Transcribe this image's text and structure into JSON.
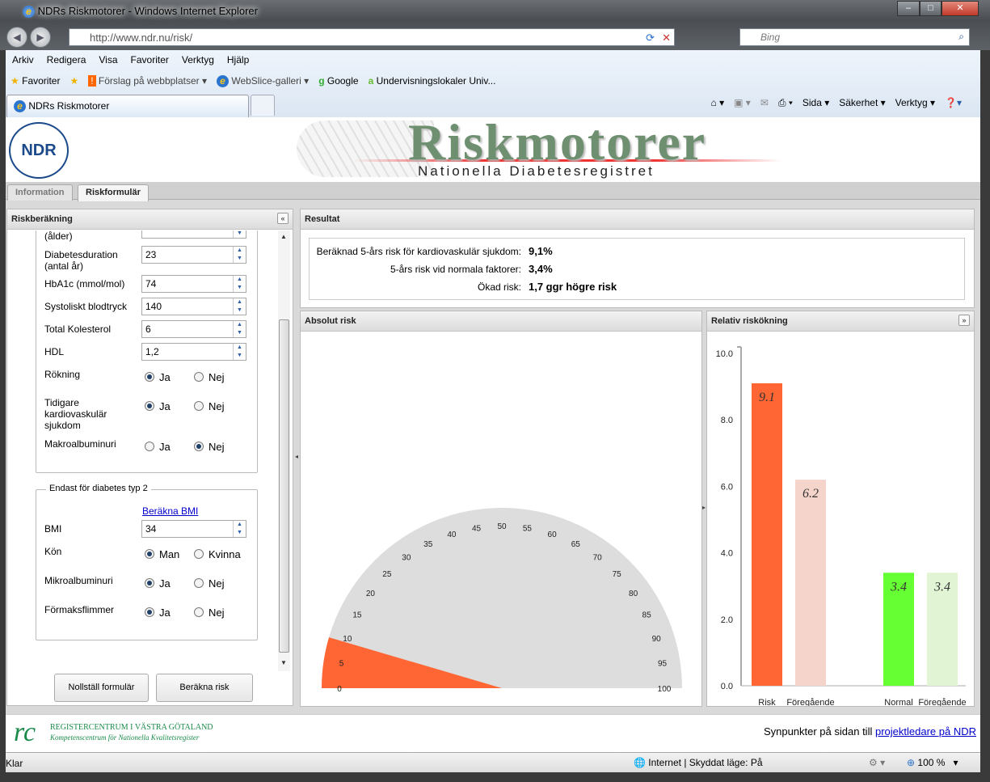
{
  "window": {
    "title": "NDRs Riskmotorer - Windows Internet Explorer",
    "url": "http://www.ndr.nu/risk/",
    "search_placeholder": "Bing",
    "minimize": "‒",
    "maximize": "□",
    "close": "✕"
  },
  "menu": [
    "Arkiv",
    "Redigera",
    "Visa",
    "Favoriter",
    "Verktyg",
    "Hjälp"
  ],
  "favorites": {
    "label": "Favoriter",
    "items": [
      "Förslag på webbplatser ▾",
      "WebSlice-galleri ▾",
      "Google",
      "Undervisningslokaler Univ..."
    ]
  },
  "browser_tab": "NDRs Riskmotorer",
  "commands": [
    "Sida ▾",
    "Säkerhet ▾",
    "Verktyg ▾"
  ],
  "banner": {
    "logo": "NDR",
    "title": "Riskmotorer",
    "subtitle": "Nationella Diabetesregistret"
  },
  "page_tabs": [
    "Information",
    "Riskformulär"
  ],
  "form": {
    "title": "Riskberäkning",
    "fields": [
      {
        "label": "(ålder)",
        "value": ""
      },
      {
        "label": "Diabetesduration (antal år)",
        "value": "23"
      },
      {
        "label": "HbA1c (mmol/mol)",
        "value": "74"
      },
      {
        "label": "Systoliskt blodtryck",
        "value": "140"
      },
      {
        "label": "Total Kolesterol",
        "value": "6"
      },
      {
        "label": "HDL",
        "value": "1,2"
      }
    ],
    "radios": [
      {
        "label": "Rökning",
        "options": [
          "Ja",
          "Nej"
        ],
        "selected": 0
      },
      {
        "label": "Tidigare kardiovaskulär sjukdom",
        "options": [
          "Ja",
          "Nej"
        ],
        "selected": 0
      },
      {
        "label": "Makroalbuminuri",
        "options": [
          "Ja",
          "Nej"
        ],
        "selected": 1
      }
    ],
    "type2": {
      "legend": "Endast för diabetes typ 2",
      "bmi_link": "Beräkna BMI",
      "bmi_label": "BMI",
      "bmi_value": "34",
      "radios": [
        {
          "label": "Kön",
          "options": [
            "Man",
            "Kvinna"
          ],
          "selected": 0
        },
        {
          "label": "Mikroalbuminuri",
          "options": [
            "Ja",
            "Nej"
          ],
          "selected": 0
        },
        {
          "label": "Förmaksflimmer",
          "options": [
            "Ja",
            "Nej"
          ],
          "selected": 0
        }
      ]
    },
    "reset_button": "Nollställ formulär",
    "calc_button": "Beräkna risk"
  },
  "result": {
    "title": "Resultat",
    "rows": [
      {
        "label": "Beräknad 5-års risk för kardiovaskulär sjukdom:",
        "value": "9,1%"
      },
      {
        "label": "5-års risk vid normala faktorer:",
        "value": "3,4%"
      },
      {
        "label": "Ökad risk:",
        "value": "1,7 ggr högre risk"
      }
    ]
  },
  "absolute_risk": {
    "title": "Absolut risk",
    "gauge_value": 9.1,
    "gauge_min": 0,
    "gauge_max": 100,
    "ticks": [
      "0",
      "5",
      "10",
      "15",
      "20",
      "25",
      "30",
      "35",
      "40",
      "45",
      "50",
      "55",
      "60",
      "65",
      "70",
      "75",
      "80",
      "85",
      "90",
      "95",
      "100"
    ],
    "fill_color": "#ff6633",
    "track_color": "#dddddd"
  },
  "chart_data": {
    "type": "bar",
    "title": "Relativ riskökning",
    "categories": [
      "Risk",
      "Föregående",
      "Normal",
      "Föregående"
    ],
    "values": [
      9.1,
      6.2,
      3.4,
      3.4
    ],
    "value_labels": [
      "9.1",
      "6.2",
      "3.4",
      "3.4"
    ],
    "colors": [
      "#ff6633",
      "#f5d5cb",
      "#66ff33",
      "#e1f5d5"
    ],
    "ylim": [
      0,
      10
    ],
    "yticks": [
      "0.0",
      "2.0",
      "4.0",
      "6.0",
      "8.0",
      "10.0"
    ],
    "grid": false
  },
  "footer": {
    "org": "REGISTERCENTRUM I VÄSTRA GÖTALAND",
    "org_sub": "Kompetenscentrum för Nationella Kvalitetsregister",
    "text": "Synpunkter på sidan till",
    "link": "projektledare på NDR"
  },
  "status": {
    "left": "Klar",
    "zone": "Internet | Skyddat läge: På",
    "zoom": "100 %"
  }
}
